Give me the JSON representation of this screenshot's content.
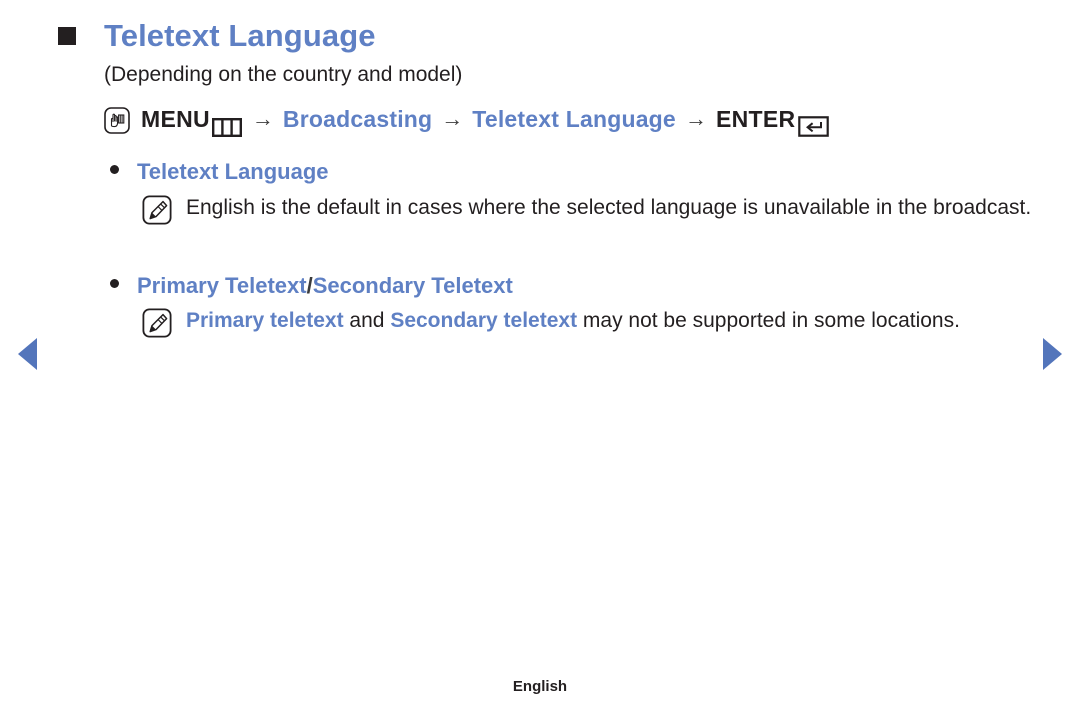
{
  "page": {
    "title": "Teletext Language",
    "subtitle": "(Depending on the country and model)",
    "footer_label": "English",
    "accent_color": "#5f80c4",
    "text_color": "#231f20",
    "arrow_color": "#5375bb"
  },
  "nav_path": {
    "menu_icon": "menu-touch-icon",
    "menu_label": "MENU",
    "grid_icon": "menu-grid-icon",
    "arrow1": "→",
    "step_broadcasting": "Broadcasting",
    "arrow2": "→",
    "step_teletext_language": "Teletext Language",
    "arrow3": "→",
    "enter_label": "ENTER",
    "enter_icon": "return-arrow-icon"
  },
  "sections": [
    {
      "bullet_label": "Teletext Language",
      "note_icon": "note-pencil-icon",
      "note_parts": [
        {
          "text": "English is the default in cases where the selected language is unavailable in the broadcast.",
          "style": "plain"
        }
      ],
      "note_plain": "English is the default in cases where the selected language is unavailable in the broadcast."
    },
    {
      "bullet_label_primary": "Primary Teletext",
      "bullet_separator": " / ",
      "bullet_label_secondary": "Secondary Teletext",
      "note_icon": "note-pencil-icon",
      "note_seg1": "Primary teletext",
      "note_seg2": " and ",
      "note_seg3": "Secondary teletext",
      "note_seg4": " may not be supported in some locations."
    }
  ],
  "navigation": {
    "prev_label": "previous-page",
    "next_label": "next-page"
  }
}
